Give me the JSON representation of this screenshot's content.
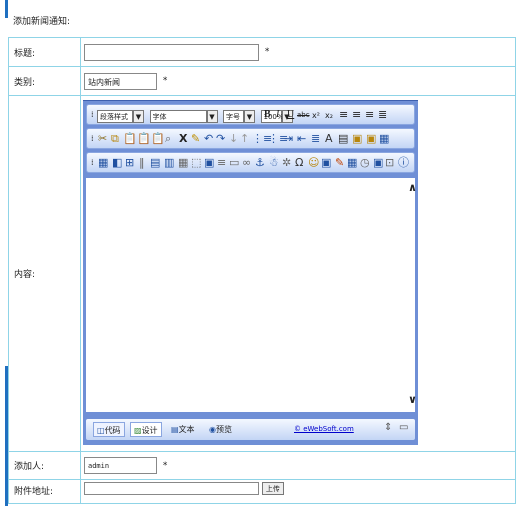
{
  "page": {
    "title": "添加新闻通知:"
  },
  "form": {
    "title_label": "标题:",
    "title_value": "",
    "category_label": "类别:",
    "category_value": "站内新闻",
    "content_label": "内容:",
    "author_label": "添加人:",
    "author_value": "admin",
    "attachment_label": "附件地址:",
    "attachment_button": "上传",
    "required_mark": "*"
  },
  "editor": {
    "row1": {
      "paragraph_style": "段落样式",
      "font": "字体",
      "font_size": "字号",
      "zoom": "100%",
      "format_glyphs": [
        "B",
        "I",
        "U",
        "abc",
        "x²",
        "x₂"
      ]
    },
    "row2_icons": [
      "cut-icon",
      "copy-icon",
      "paste-icon",
      "paste-text-icon",
      "paste-word-icon",
      "find-icon",
      "remove-format-icon",
      "select-all-icon",
      "undo-icon",
      "redo-icon",
      "lower-icon",
      "upper-icon",
      "ordered-list-icon",
      "bullet-list-icon",
      "indent-icon",
      "outdent-icon",
      "justify-icon",
      "font-color-icon",
      "bg-color-icon",
      "image-icon",
      "flash-icon"
    ],
    "row3_icons": [
      "table-icon",
      "cell-icon",
      "row-icon",
      "col-icon",
      "merge-icon",
      "split-icon",
      "form-icon",
      "hr-icon",
      "link-icon",
      "anchor-icon",
      "special-char-icon",
      "emoticon-icon",
      "media-icon",
      "date-icon",
      "time-icon",
      "help-icon"
    ],
    "mode_tabs": {
      "code": "代码",
      "design": "设计",
      "text": "文本",
      "preview": "预览"
    },
    "brand": "© eWebSoft.com"
  },
  "colors": {
    "accent": "#1f6fc0",
    "border": "#8fd4e7",
    "toolbar": "#6f8fd6"
  }
}
